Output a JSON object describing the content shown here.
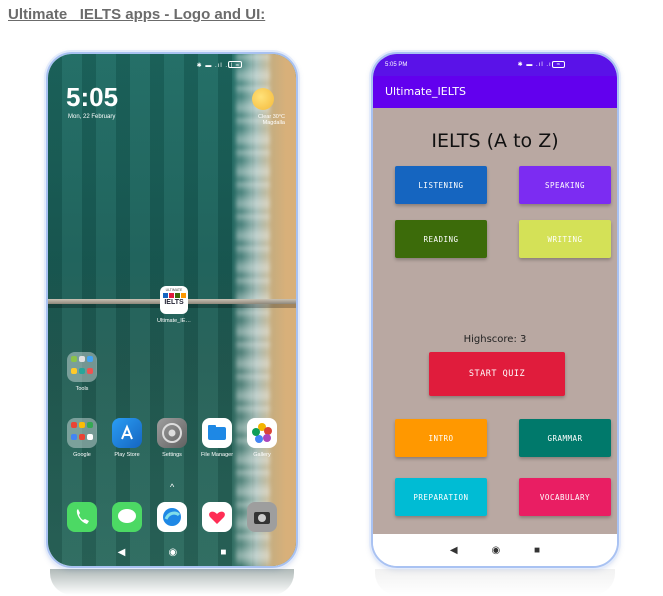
{
  "document": {
    "title": "Ultimate_ IELTS apps - Logo and UI:"
  },
  "home_screen": {
    "clock": "5:05",
    "date": "Mon, 22 February",
    "weather": {
      "condition": "Clear",
      "temperature": "30°C",
      "location": "Magdalla"
    },
    "status_icons": "✱ ▬ .ıl .ıl ≈",
    "battery": "76",
    "shortcut": {
      "label": "Ultimate_IE…",
      "icon_top": "ULTIMATE",
      "icon_word": "IELTS"
    },
    "folders": [
      {
        "label": "Tools"
      },
      {
        "label": "Google"
      }
    ],
    "apps": [
      {
        "label": "Play Store",
        "icon": "play-store-icon"
      },
      {
        "label": "Settings",
        "icon": "settings-icon"
      },
      {
        "label": "File Manager",
        "icon": "file-manager-icon"
      },
      {
        "label": "Gallery",
        "icon": "gallery-icon"
      }
    ],
    "dock": [
      "phone-icon",
      "messages-icon",
      "browser-icon",
      "health-icon",
      "camera-icon"
    ],
    "swipe_hint": "^",
    "nav": {
      "back": "◀",
      "home": "◉",
      "recents": "■"
    }
  },
  "app_screen": {
    "status_time": "5:05 PM",
    "status_icons": "✱ ▬ .ıl .ıl ≈",
    "app_title": "Ultimate_IELTS",
    "heading": "IELTS (A to Z)",
    "buttons": {
      "listening": "LISTENING",
      "speaking": "SPEAKING",
      "reading": "READING",
      "writing": "WRITING",
      "start_quiz": "START QUIZ",
      "intro": "INTRO",
      "grammar": "GRAMMAR",
      "preparation": "PREPARATION",
      "vocabulary": "VOCABULARY"
    },
    "highscore": "Highscore: 3",
    "nav": {
      "back": "◀",
      "home": "◉",
      "recents": "■"
    }
  },
  "colors": {
    "app_bar": "#6200ee",
    "status_bar": "#5a12e8",
    "app_background": "#b9a8a2",
    "listening": "#1565c0",
    "speaking": "#7c2cf2",
    "reading": "#3c6b0a",
    "writing": "#d4e157",
    "start_quiz": "#e01c3c",
    "intro": "#ff9800",
    "grammar": "#00796b",
    "preparation": "#00bcd4",
    "vocabulary": "#e91e63"
  }
}
